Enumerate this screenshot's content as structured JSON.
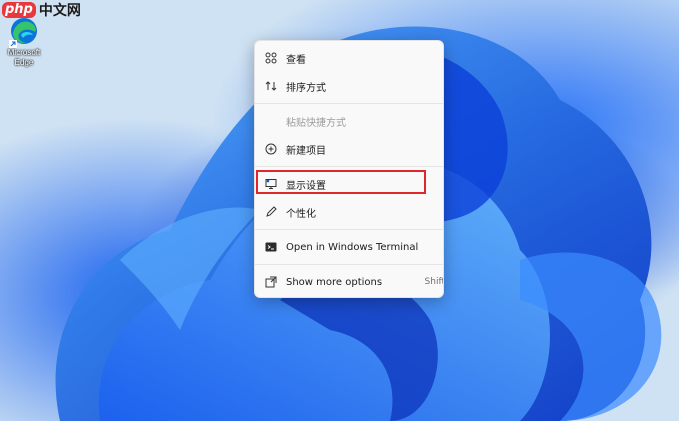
{
  "watermark": {
    "php": "php",
    "cn": "中文网"
  },
  "desktop_icon": {
    "label": "Microsoft Edge",
    "icon": "edge-icon"
  },
  "menu": {
    "items": [
      {
        "label": "查看",
        "icon": "view-grid-icon"
      },
      {
        "label": "排序方式",
        "icon": "sort-icon"
      },
      {
        "label": "粘贴快捷方式",
        "icon": "none",
        "disabled": true
      },
      {
        "label": "新建项目",
        "icon": "new-item-icon"
      },
      {
        "label": "显示设置",
        "icon": "display-settings-icon"
      },
      {
        "label": "个性化",
        "icon": "pen-icon"
      },
      {
        "label": "Open in Windows Terminal",
        "icon": "terminal-icon"
      },
      {
        "label": "Show more options",
        "icon": "more-options-icon",
        "shortcut": "Shift"
      }
    ]
  },
  "colors": {
    "highlight": "#e0262d",
    "accent": "#0a59d6"
  }
}
